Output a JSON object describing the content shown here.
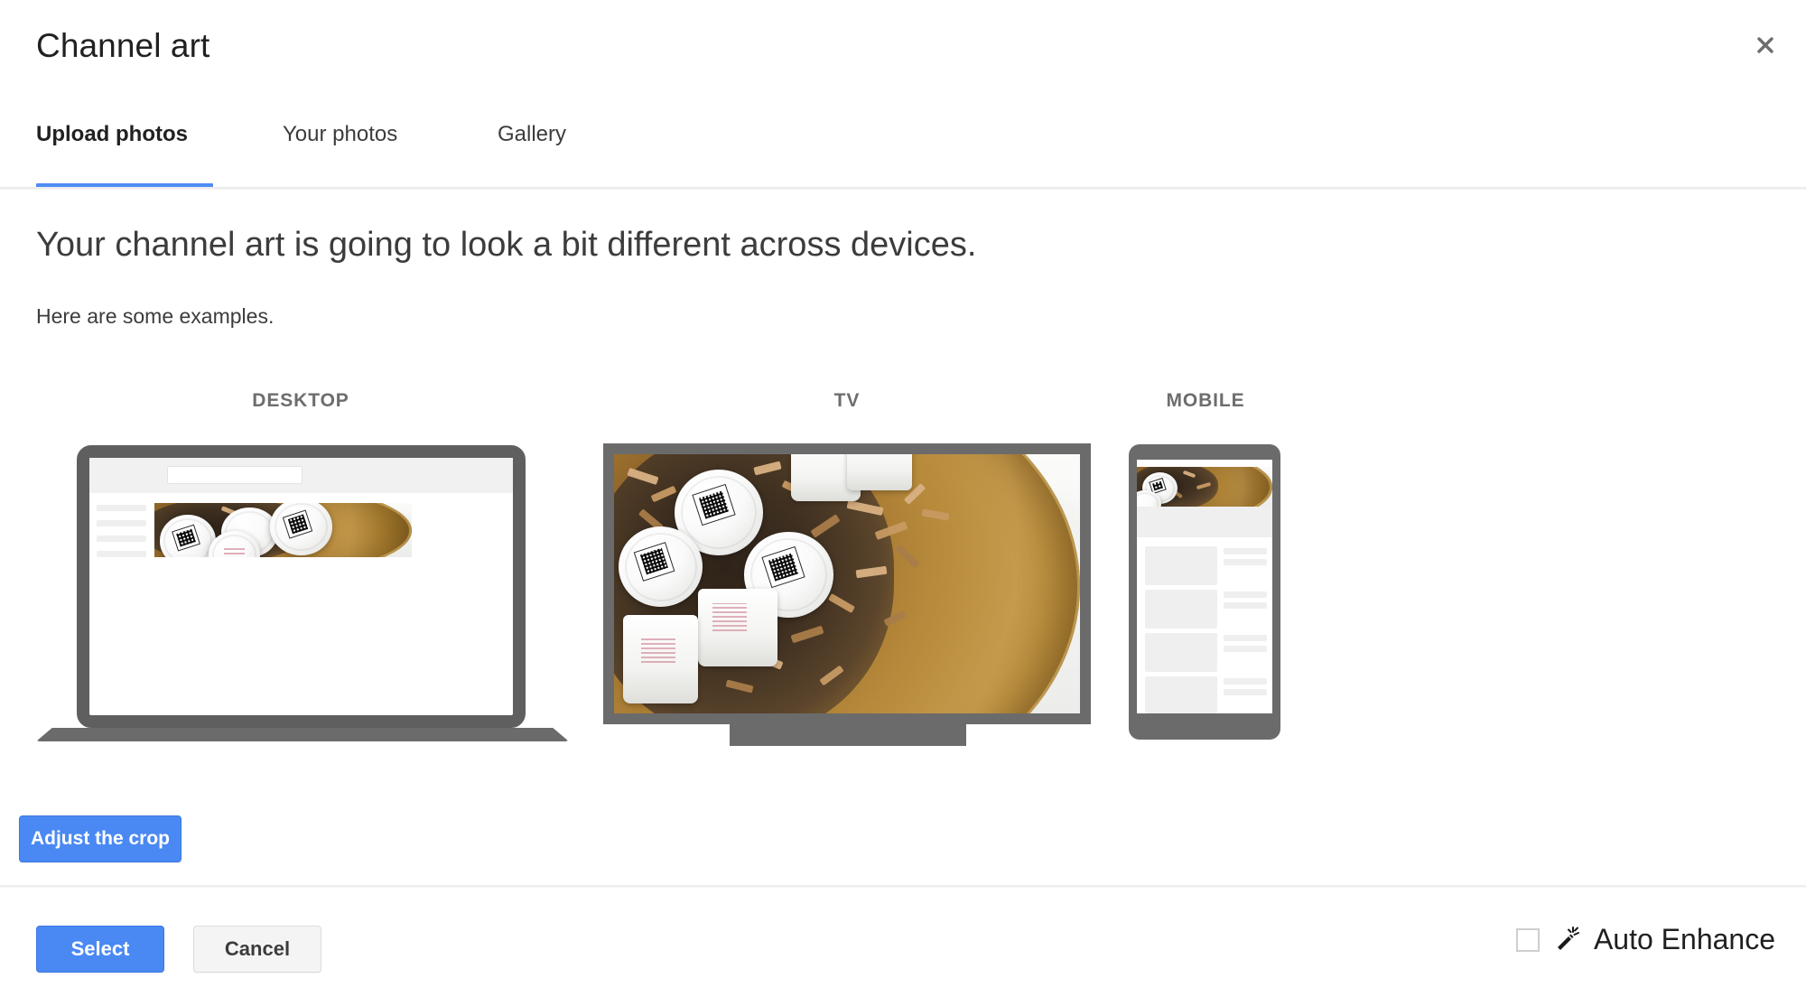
{
  "dialog": {
    "title": "Channel art",
    "close_icon": "close-icon"
  },
  "tabs": [
    {
      "label": "Upload photos",
      "active": true
    },
    {
      "label": "Your photos",
      "active": false
    },
    {
      "label": "Gallery",
      "active": false
    }
  ],
  "main": {
    "headline": "Your channel art is going to look a bit different across devices.",
    "subline": "Here are some examples.",
    "adjust_crop_label": "Adjust the crop"
  },
  "previews": [
    {
      "label": "DESKTOP",
      "device": "laptop"
    },
    {
      "label": "TV",
      "device": "tv"
    },
    {
      "label": "MOBILE",
      "device": "mobile"
    }
  ],
  "footer": {
    "select_label": "Select",
    "cancel_label": "Cancel",
    "auto_enhance_label": "Auto Enhance",
    "auto_enhance_checked": false,
    "wand_icon": "magic-wand-icon"
  },
  "colors": {
    "accent_blue": "#4a89f3",
    "tab_underline": "#4e8cf5",
    "device_frame": "#6b6b6b",
    "label_gray": "#6d6d6d",
    "text_dark": "#3c3c3c"
  }
}
